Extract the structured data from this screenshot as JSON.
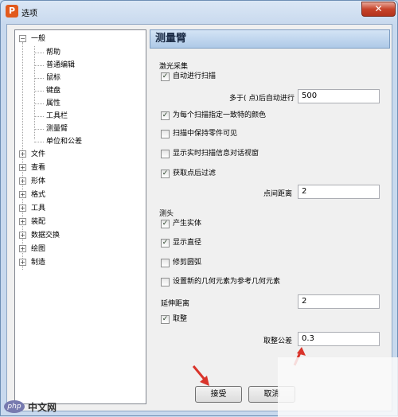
{
  "window": {
    "app_icon": "P",
    "title": "选项",
    "close": "✕"
  },
  "tree": {
    "root": {
      "toggle": "−",
      "label": "一般"
    },
    "children": [
      "帮助",
      "普通编辑",
      "鼠标",
      "键盘",
      "属性",
      "工具栏",
      "测量臂",
      "单位和公差"
    ],
    "groups": [
      {
        "toggle": "+",
        "label": "文件"
      },
      {
        "toggle": "+",
        "label": "查看"
      },
      {
        "toggle": "+",
        "label": "形体"
      },
      {
        "toggle": "+",
        "label": "格式"
      },
      {
        "toggle": "+",
        "label": "工具"
      },
      {
        "toggle": "+",
        "label": "装配"
      },
      {
        "toggle": "+",
        "label": "数据交换"
      },
      {
        "toggle": "+",
        "label": "绘图"
      },
      {
        "toggle": "+",
        "label": "制造"
      }
    ]
  },
  "panel": {
    "title": "测量臂",
    "laser": {
      "label": "激光采集",
      "auto_scan": {
        "label": "自动进行扫描",
        "checked": "✓"
      },
      "auto_after_label": "多于( 点)后自动进行",
      "auto_after_value": "500",
      "unique_color": {
        "label": "为每个扫描指定一致特的颜色",
        "checked": "✓"
      },
      "keep_part_visible": {
        "label": "扫描中保持零件可见",
        "checked": ""
      },
      "show_realtime": {
        "label": "显示实时扫描信息对话视窗",
        "checked": ""
      },
      "filter_points": {
        "label": "获取点后过滤",
        "checked": "✓"
      },
      "point_spacing_label": "点间距离",
      "point_spacing_value": "2"
    },
    "probe": {
      "label": "测头",
      "create_solid": {
        "label": "产生实体",
        "checked": "✓"
      },
      "show_diameter": {
        "label": "显示直径",
        "checked": "✓"
      },
      "trim_circle": {
        "label": "修剪圆弧",
        "checked": ""
      },
      "set_reference": {
        "label": "设置新的几何元素为参考几何元素",
        "checked": ""
      },
      "extend_distance_label": "延伸距离",
      "extend_distance_value": "2",
      "round": {
        "label": "取整",
        "checked": "✓"
      },
      "round_tolerance_label": "取整公差",
      "round_tolerance_value": "0.3"
    }
  },
  "buttons": {
    "accept": "接受",
    "cancel": "取消"
  },
  "watermark": {
    "php": "php",
    "text": "中文网"
  },
  "colors": {
    "accent_arrow": "#d9342b",
    "header_bg": "#aec9e7"
  }
}
